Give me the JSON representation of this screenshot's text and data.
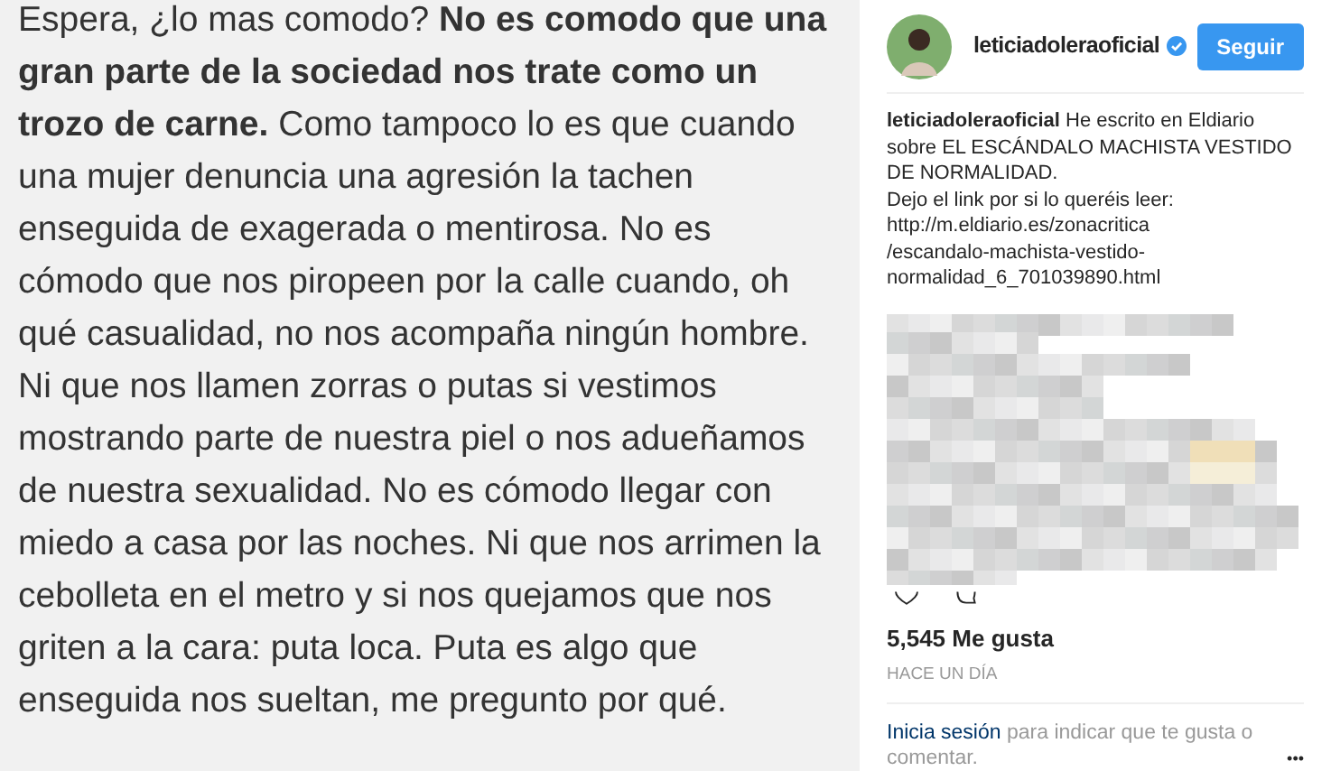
{
  "post_text": "Espera, ¿lo mas comodo?  **No es comodo que una gran parte de la sociedad nos trate como un trozo de carne.** Como tampoco lo es que cuando una mujer denuncia una agresión la tachen enseguida de exagerada o mentirosa. No es cómodo que nos piropeen por la calle cuando, oh qué casualidad, no nos acompaña ningún hombre. Ni que nos llamen zorras o putas si vestimos mostrando parte de nuestra piel o nos adueñamos de nuestra sexualidad. No es cómodo llegar con miedo a casa por las noches. Ni que nos arrimen la cebolleta en el metro y si nos quejamos que nos griten a la cara: puta loca. Puta es algo que enseguida nos sueltan, me pregunto por qué.",
  "header": {
    "username": "leticiadoleraoficial",
    "verified": true,
    "follow_button": "Seguir"
  },
  "caption": {
    "username": "leticiadoleraoficial",
    "text": "He escrito en Eldiario sobre EL ESCÁNDALO MACHISTA VESTIDO DE NORMALIDAD.\nDejo el link por si lo queréis leer:\nhttp://m.eldiario.es/zonacritica\n/escandalo-machista-vestido-\nnormalidad_6_701039890.html"
  },
  "likes": "5,545 Me gusta",
  "time": "HACE UN DÍA",
  "footer": {
    "login_link": "Inicia sesión",
    "text": "para indicar que te gusta o comentar.",
    "more": "•••"
  }
}
